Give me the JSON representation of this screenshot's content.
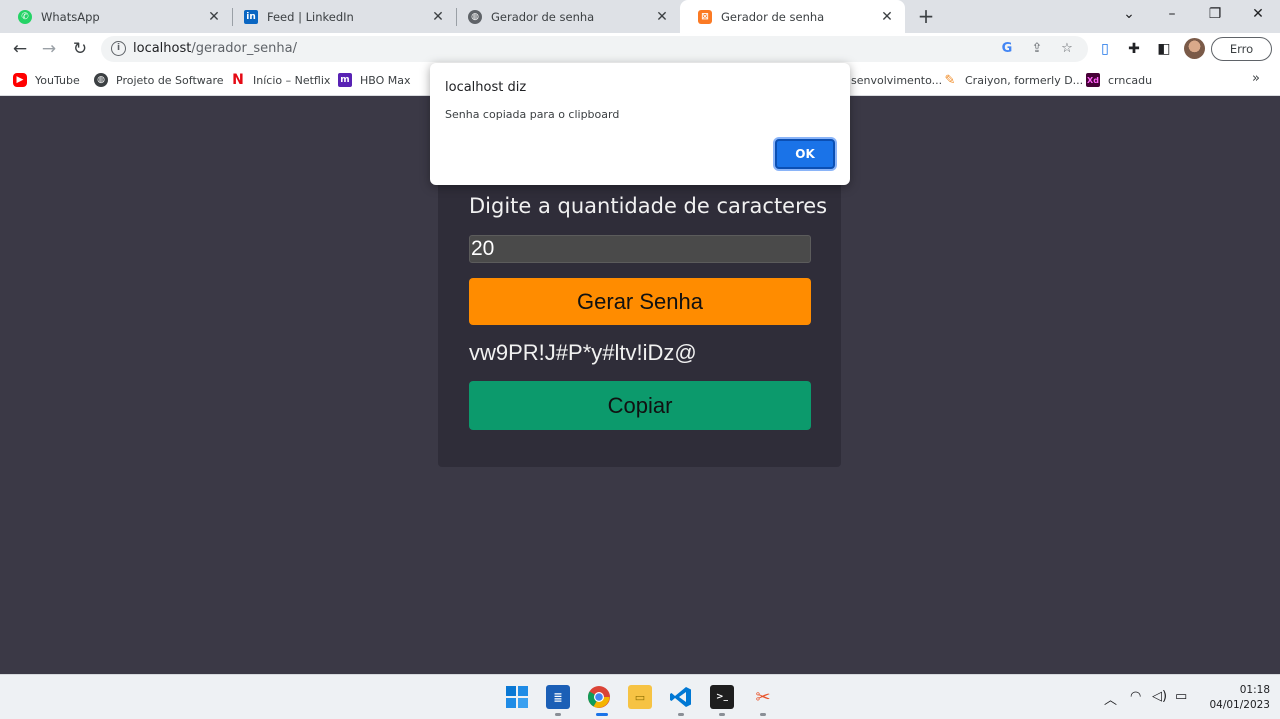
{
  "browser": {
    "tabs": [
      {
        "title": "WhatsApp",
        "icon": "whatsapp-icon",
        "color": "#25d366",
        "active": false
      },
      {
        "title": "Feed | LinkedIn",
        "icon": "linkedin-icon",
        "color": "#0a66c2",
        "active": false
      },
      {
        "title": "Gerador de senha",
        "icon": "globe-icon",
        "color": "#5f6368",
        "active": false
      },
      {
        "title": "Gerador de senha",
        "icon": "xampp-icon",
        "color": "#fb7a24",
        "active": true
      }
    ],
    "url_host": "localhost",
    "url_path": "/gerador_senha/",
    "profile_status": "Erro",
    "bookmarks": [
      {
        "label": "YouTube",
        "icon": "youtube-icon",
        "color": "#ff0000"
      },
      {
        "label": "Projeto de Software",
        "icon": "globe-icon",
        "color": "#3c4043"
      },
      {
        "label": "Início – Netflix",
        "icon": "netflix-icon",
        "color": "#e50914"
      },
      {
        "label": "HBO Max",
        "icon": "hbomax-icon",
        "color": "#5822b4"
      },
      {
        "label": "senvolvimento...",
        "icon": "",
        "color": ""
      },
      {
        "label": "Craiyon, formerly D...",
        "icon": "pencil-icon",
        "color": "#f08a24"
      },
      {
        "label": "crncadu",
        "icon": "xd-icon",
        "color": "#470137"
      }
    ]
  },
  "dialog": {
    "title": "localhost diz",
    "message": "Senha copiada para o clipboard",
    "ok_label": "OK"
  },
  "app": {
    "label": "Digite a quantidade de caracteres",
    "quantity": "20",
    "generate_label": "Gerar Senha",
    "password": "vw9PR!J#P*y#ltv!iDz@",
    "copy_label": "Copiar",
    "colors": {
      "background": "#3b3946",
      "card": "#2f2d39",
      "generate": "#ff8c00",
      "copy": "#0c9a6c"
    }
  },
  "taskbar": {
    "time": "01:18",
    "date": "04/01/2023"
  }
}
